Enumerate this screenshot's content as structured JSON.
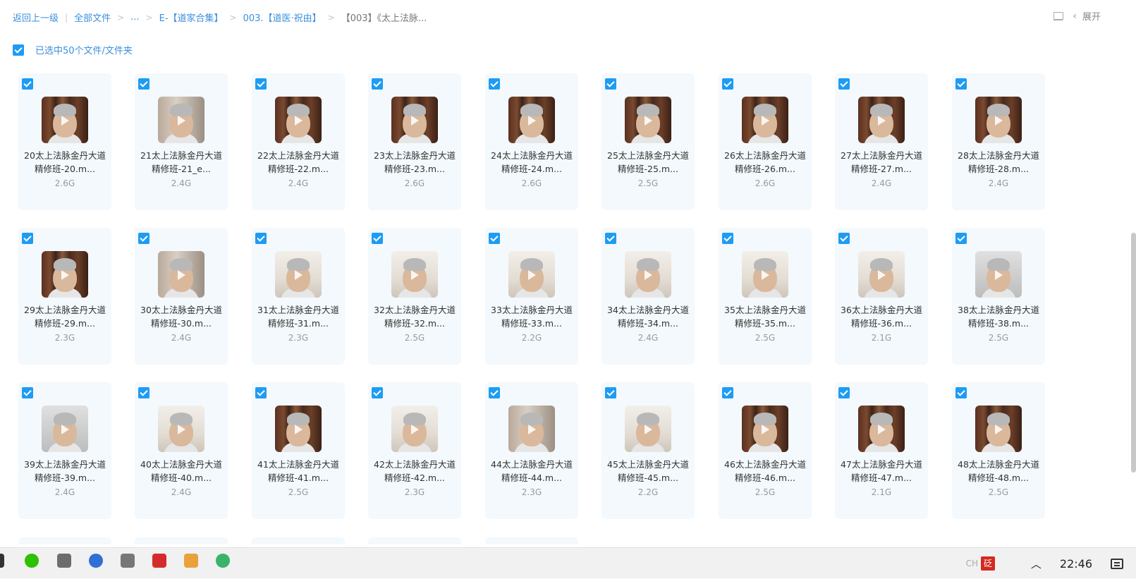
{
  "breadcrumb": {
    "back": "返回上一级",
    "all_files": "全部文件",
    "ellipsis": "...",
    "level1": "E-【道家合集】",
    "level2": "003.【道医·祝由】",
    "current": "【003】《太上法脉..."
  },
  "header": {
    "expand_label": "展开"
  },
  "selection": {
    "text": "已选中50个文件/文件夹"
  },
  "icons": {
    "list_view": "list-view-icon",
    "chevron": "chevron-left-icon",
    "checkbox": "checkbox-checked-icon",
    "play": "play-icon"
  },
  "colors": {
    "accent": "#1e9cf4",
    "link": "#3b8fdd",
    "card_bg": "#f3f9fd"
  },
  "files": [
    {
      "name": "20太上法脉金丹大道精修班-20.m...",
      "size": "2.6G",
      "thumb": "shelf"
    },
    {
      "name": "21太上法脉金丹大道精修班-21_e...",
      "size": "2.4G",
      "thumb": "room"
    },
    {
      "name": "22太上法脉金丹大道精修班-22.m...",
      "size": "2.4G",
      "thumb": "shelf"
    },
    {
      "name": "23太上法脉金丹大道精修班-23.m...",
      "size": "2.6G",
      "thumb": "shelf"
    },
    {
      "name": "24太上法脉金丹大道精修班-24.m...",
      "size": "2.6G",
      "thumb": "shelf"
    },
    {
      "name": "25太上法脉金丹大道精修班-25.m...",
      "size": "2.5G",
      "thumb": "shelf"
    },
    {
      "name": "26太上法脉金丹大道精修班-26.m...",
      "size": "2.6G",
      "thumb": "shelf"
    },
    {
      "name": "27太上法脉金丹大道精修班-27.m...",
      "size": "2.4G",
      "thumb": "shelf"
    },
    {
      "name": "28太上法脉金丹大道精修班-28.m...",
      "size": "2.4G",
      "thumb": "shelf"
    },
    {
      "name": "29太上法脉金丹大道精修班-29.m...",
      "size": "2.3G",
      "thumb": "shelf"
    },
    {
      "name": "30太上法脉金丹大道精修班-30.m...",
      "size": "2.4G",
      "thumb": "room"
    },
    {
      "name": "31太上法脉金丹大道精修班-31.m...",
      "size": "2.3G",
      "thumb": "light"
    },
    {
      "name": "32太上法脉金丹大道精修班-32.m...",
      "size": "2.5G",
      "thumb": "light"
    },
    {
      "name": "33太上法脉金丹大道精修班-33.m...",
      "size": "2.2G",
      "thumb": "light"
    },
    {
      "name": "34太上法脉金丹大道精修班-34.m...",
      "size": "2.4G",
      "thumb": "light"
    },
    {
      "name": "35太上法脉金丹大道精修班-35.m...",
      "size": "2.5G",
      "thumb": "light"
    },
    {
      "name": "36太上法脉金丹大道精修班-36.m...",
      "size": "2.1G",
      "thumb": "light"
    },
    {
      "name": "38太上法脉金丹大道精修班-38.m...",
      "size": "2.5G",
      "thumb": "gray"
    },
    {
      "name": "39太上法脉金丹大道精修班-39.m...",
      "size": "2.4G",
      "thumb": "gray"
    },
    {
      "name": "40太上法脉金丹大道精修班-40.m...",
      "size": "2.4G",
      "thumb": "light"
    },
    {
      "name": "41太上法脉金丹大道精修班-41.m...",
      "size": "2.5G",
      "thumb": "shelf"
    },
    {
      "name": "42太上法脉金丹大道精修班-42.m...",
      "size": "2.3G",
      "thumb": "light"
    },
    {
      "name": "44太上法脉金丹大道精修班-44.m...",
      "size": "2.3G",
      "thumb": "room"
    },
    {
      "name": "45太上法脉金丹大道精修班-45.m...",
      "size": "2.2G",
      "thumb": "light"
    },
    {
      "name": "46太上法脉金丹大道精修班-46.m...",
      "size": "2.5G",
      "thumb": "shelf"
    },
    {
      "name": "47太上法脉金丹大道精修班-47.m...",
      "size": "2.1G",
      "thumb": "shelf"
    },
    {
      "name": "48太上法脉金丹大道精修班-48.m...",
      "size": "2.5G",
      "thumb": "shelf"
    }
  ],
  "taskbar": {
    "apps": [
      "wechat-icon",
      "calculator-icon",
      "baidu-netdisk-icon",
      "notepad-icon",
      "wps-icon",
      "paint-icon",
      "browser-icon"
    ],
    "time": "22:46",
    "ime_label": "CH",
    "ime_seal": "砭"
  }
}
